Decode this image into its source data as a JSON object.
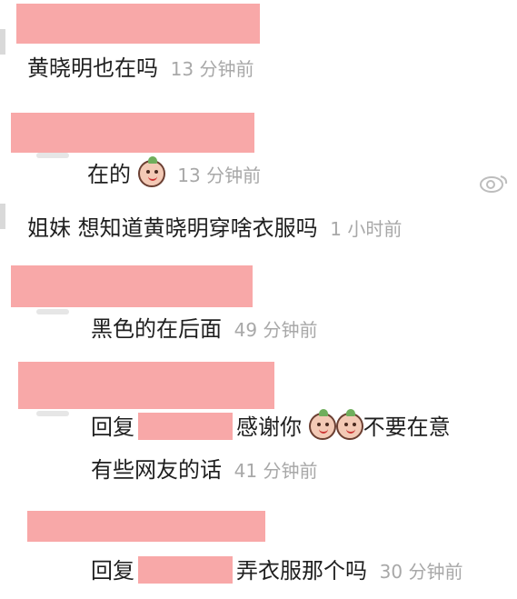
{
  "comments": [
    {
      "text": "黄晓明也在吗",
      "time": "13 分钟前"
    },
    {
      "text": "在的",
      "time": "13 分钟前",
      "sticker": "peach-face-icon"
    },
    {
      "text": "姐妹 想知道黄晓明穿啥衣服吗",
      "time": "1 小时前"
    },
    {
      "text": "黑色的在后面",
      "time": "49 分钟前"
    },
    {
      "reply_prefix": "回复",
      "text_a": "感谢你",
      "text_b": "不要在意",
      "text_c": "有些网友的话",
      "time": "41 分钟前",
      "sticker": "peach-face-icon"
    },
    {
      "reply_prefix": "回复",
      "text": "弄衣服那个吗",
      "time": "30 分钟前"
    }
  ],
  "icons": {
    "weibo": "weibo-logo-icon",
    "sticker": "peach-face-icon"
  },
  "colors": {
    "redaction": "#f8a8a8",
    "timestamp": "#a8a8a8"
  }
}
